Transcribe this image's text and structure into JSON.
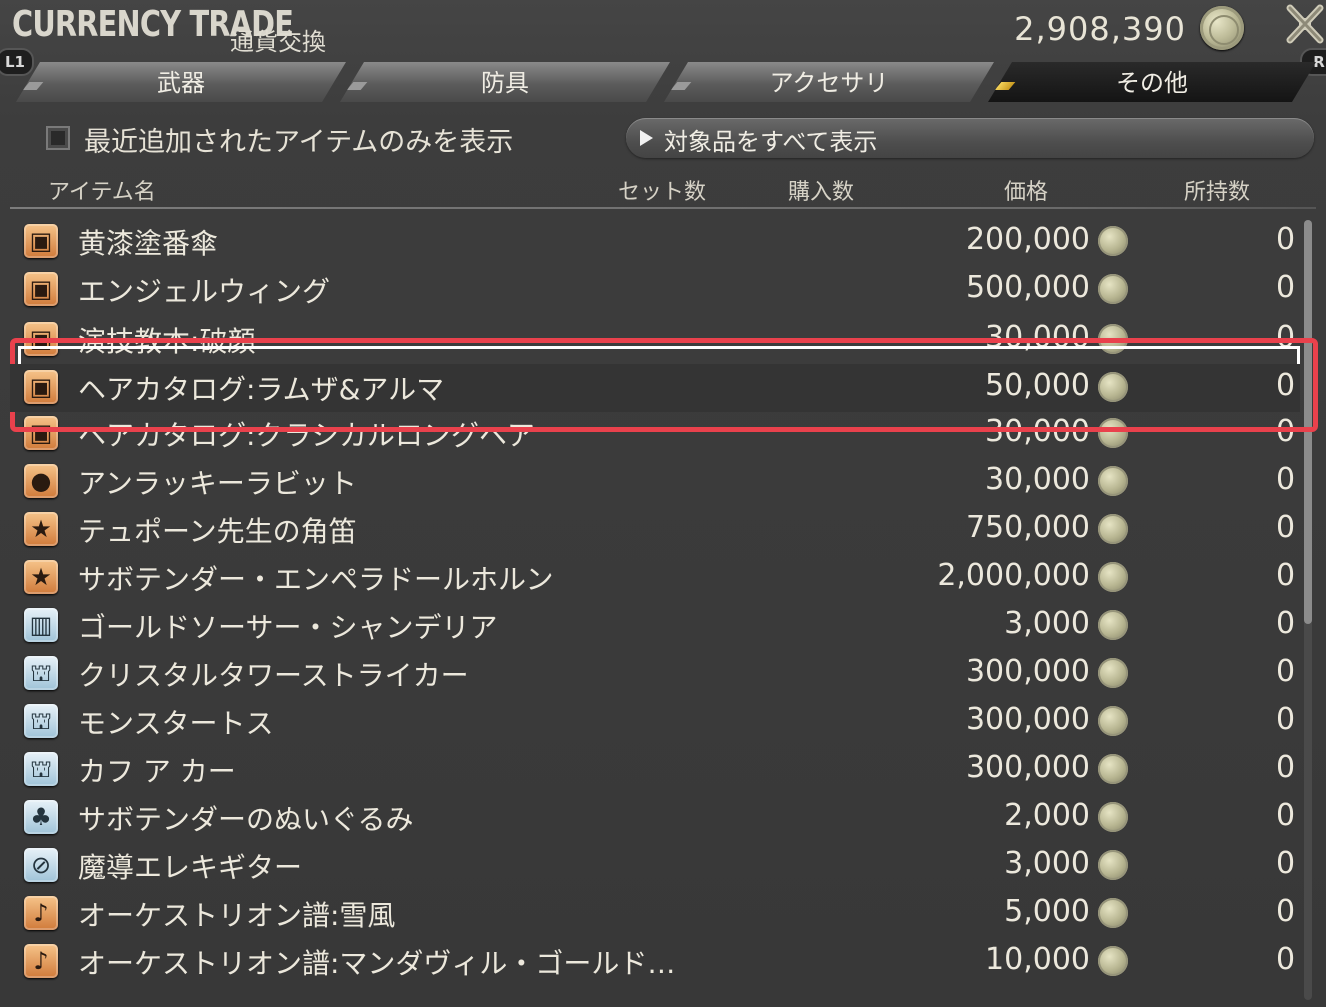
{
  "header": {
    "title_en": "CURRENCY TRADE",
    "title_jp": "通貨交換",
    "currency_amount": "2,908,390",
    "badge_left": "L1",
    "badge_right": "R"
  },
  "tabs": [
    {
      "label": "武器",
      "active": false
    },
    {
      "label": "防具",
      "active": false
    },
    {
      "label": "アクセサリ",
      "active": false
    },
    {
      "label": "その他",
      "active": true
    }
  ],
  "filter": {
    "checkbox_label": "最近追加されたアイテムのみを表示",
    "checked": false,
    "show_all_label": "対象品をすべて表示"
  },
  "columns": {
    "item_name": "アイテム名",
    "set_count": "セット数",
    "purchase_count": "購入数",
    "price": "価格",
    "owned": "所持数"
  },
  "items": [
    {
      "name": "黄漆塗番傘",
      "price": "200,000",
      "owned": "0",
      "icon": "chest-icon"
    },
    {
      "name": "エンジェルウィング",
      "price": "500,000",
      "owned": "0",
      "icon": "chest-icon"
    },
    {
      "name": "演技教本:破顔",
      "price": "30,000",
      "owned": "0",
      "icon": "chest-icon"
    },
    {
      "name": "ヘアカタログ:ラムザ&アルマ",
      "price": "50,000",
      "owned": "0",
      "icon": "chest-icon"
    },
    {
      "name": "ヘアカタログ:クラシカルロングヘア",
      "price": "30,000",
      "owned": "0",
      "icon": "chest-icon"
    },
    {
      "name": "アンラッキーラビット",
      "price": "30,000",
      "owned": "0",
      "icon": "minion-icon"
    },
    {
      "name": "テュポーン先生の角笛",
      "price": "750,000",
      "owned": "0",
      "icon": "star-icon"
    },
    {
      "name": "サボテンダー・エンペラドールホルン",
      "price": "2,000,000",
      "owned": "0",
      "icon": "star-icon"
    },
    {
      "name": "ゴールドソーサー・シャンデリア",
      "price": "3,000",
      "owned": "0",
      "icon": "furnishing-icon"
    },
    {
      "name": "クリスタルタワーストライカー",
      "price": "300,000",
      "owned": "0",
      "icon": "figure-icon"
    },
    {
      "name": "モンスタートス",
      "price": "300,000",
      "owned": "0",
      "icon": "figure-icon"
    },
    {
      "name": "カフ ア カー",
      "price": "300,000",
      "owned": "0",
      "icon": "figure-icon"
    },
    {
      "name": "サボテンダーのぬいぐるみ",
      "price": "2,000",
      "owned": "0",
      "icon": "plush-icon"
    },
    {
      "name": "魔導エレキギター",
      "price": "3,000",
      "owned": "0",
      "icon": "guitar-icon"
    },
    {
      "name": "オーケストリオン譜:雪風",
      "price": "5,000",
      "owned": "0",
      "icon": "music-note-icon"
    },
    {
      "name": "オーケストリオン譜:マンダヴィル・ゴールド…",
      "price": "10,000",
      "owned": "0",
      "icon": "music-note-icon"
    }
  ],
  "highlight": {
    "row_index": 3,
    "color": "#e9414c"
  }
}
